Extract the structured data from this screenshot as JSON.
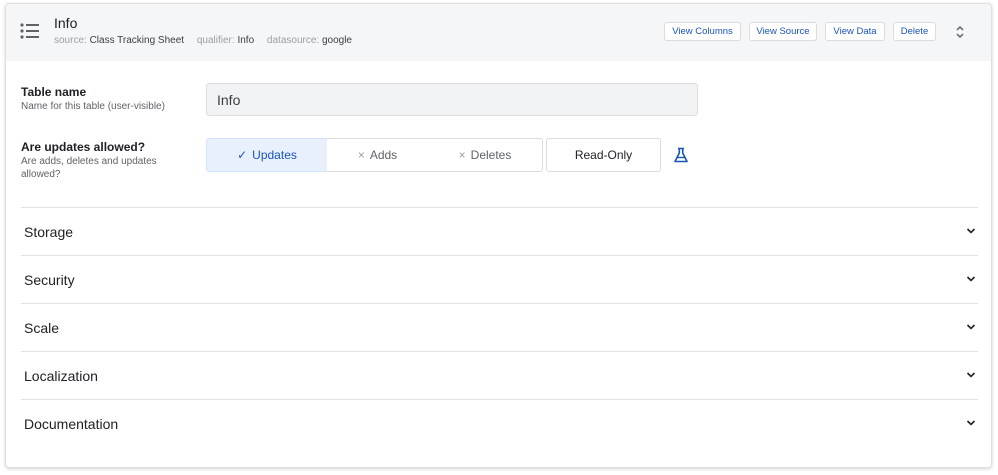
{
  "header": {
    "title": "Info",
    "meta": [
      {
        "label": "source:",
        "value": "Class Tracking Sheet"
      },
      {
        "label": "qualifier:",
        "value": "Info"
      },
      {
        "label": "datasource:",
        "value": "google"
      }
    ],
    "buttons": {
      "view_columns": "View Columns",
      "view_source": "View Source",
      "view_data": "View Data",
      "delete": "Delete"
    }
  },
  "table_name": {
    "title": "Table name",
    "description": "Name for this table (user-visible)",
    "value": "Info"
  },
  "updates": {
    "title": "Are updates allowed?",
    "description": "Are adds, deletes and updates allowed?",
    "options": {
      "updates": {
        "label": "Updates",
        "mark": "✓",
        "selected": true
      },
      "adds": {
        "label": "Adds",
        "mark": "×",
        "selected": false
      },
      "deletes": {
        "label": "Deletes",
        "mark": "×",
        "selected": false
      },
      "read_only": {
        "label": "Read-Only",
        "selected": false
      }
    }
  },
  "sections": {
    "storage": "Storage",
    "security": "Security",
    "scale": "Scale",
    "localization": "Localization",
    "documentation": "Documentation"
  },
  "colors": {
    "accent": "#1a55b8",
    "selected_bg": "#e8f0fe",
    "header_bg": "#f5f6f7"
  },
  "icons": [
    "list-icon",
    "sort-icon",
    "check-icon",
    "close-icon",
    "flask-icon",
    "chevron-down-icon"
  ]
}
